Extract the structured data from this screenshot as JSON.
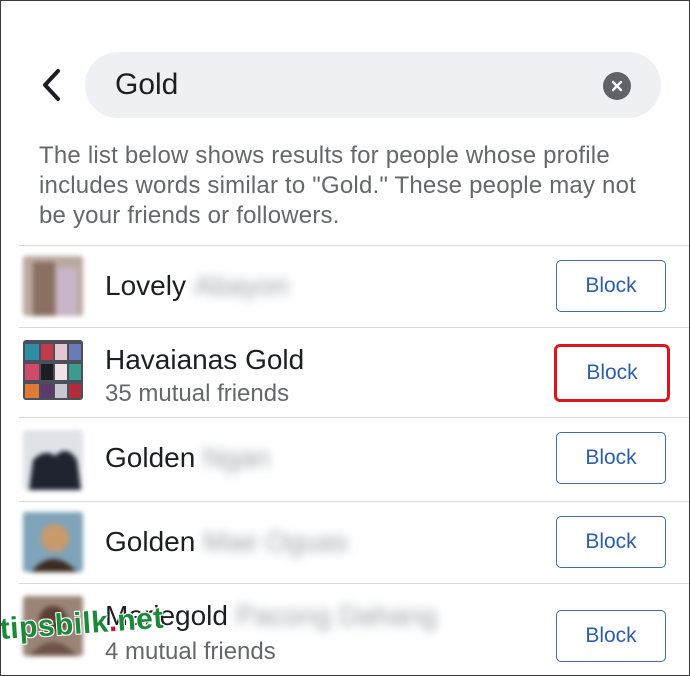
{
  "search": {
    "query": "Gold"
  },
  "description": "The list below shows results for people whose profile includes words similar to \"Gold.\" These people may not be your friends or followers.",
  "results": [
    {
      "name": "Lovely",
      "hidden_name": "Abayon",
      "subtext": "",
      "button_label": "Block",
      "highlighted": false
    },
    {
      "name": "Havaianas Gold",
      "hidden_name": "",
      "subtext": "35 mutual friends",
      "button_label": "Block",
      "highlighted": true
    },
    {
      "name": "Golden",
      "hidden_name": "Ngan",
      "subtext": "",
      "button_label": "Block",
      "highlighted": false
    },
    {
      "name": "Golden",
      "hidden_name": "Mae Oguas",
      "subtext": "",
      "button_label": "Block",
      "highlighted": false
    },
    {
      "name": "Mariegold",
      "hidden_name": "Pacong Dahang",
      "subtext": "4 mutual friends",
      "button_label": "Block",
      "highlighted": false
    }
  ],
  "watermark": {
    "part1": "tipsbilk",
    "part2": ".",
    "part3": "net"
  },
  "colors": {
    "accent": "#2d5fa8",
    "highlight": "#e0141e",
    "watermark": "#1a8a3a"
  }
}
